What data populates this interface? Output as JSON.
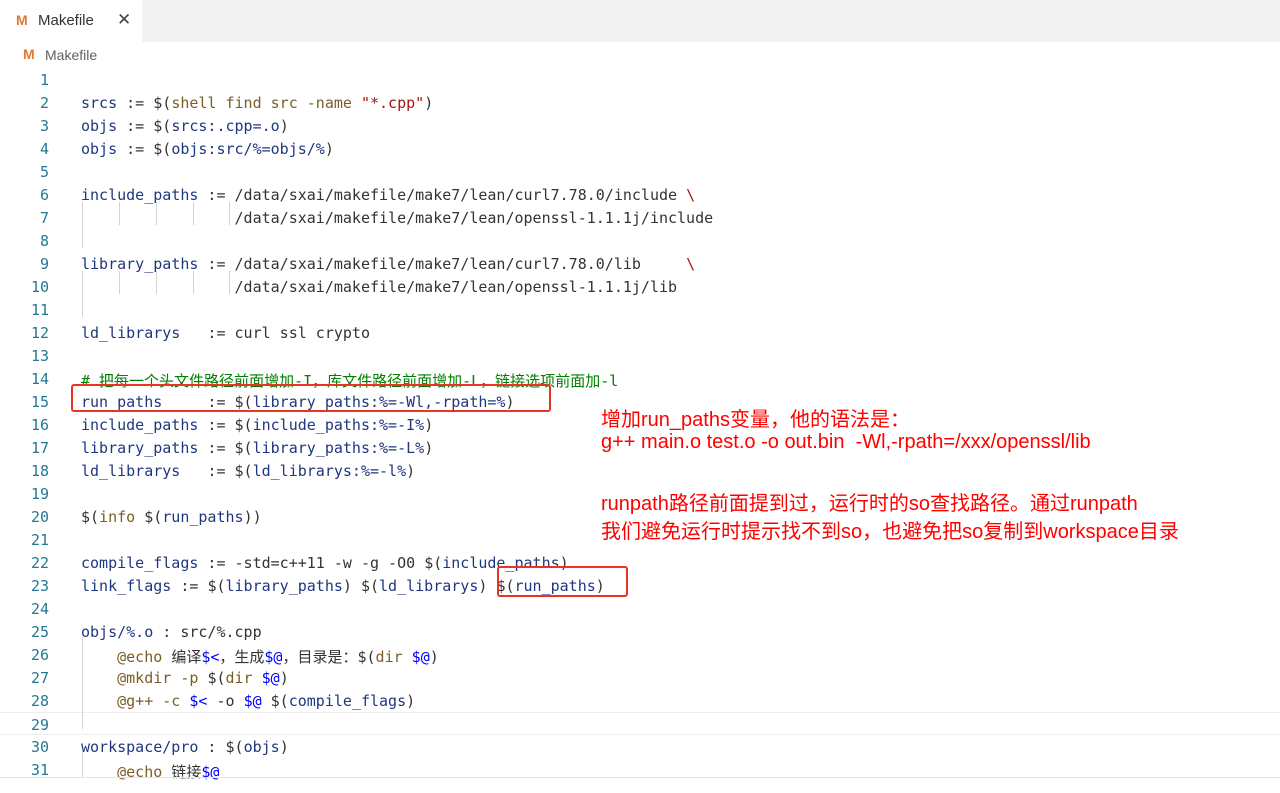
{
  "tab": {
    "icon": "M",
    "label": "Makefile",
    "close": "✕"
  },
  "breadcrumb": {
    "icon": "M",
    "label": "Makefile"
  },
  "lines": [
    {
      "n": "1",
      "seg": []
    },
    {
      "n": "2",
      "seg": [
        [
          "srcs",
          "c-var"
        ],
        [
          " := ",
          "c-op"
        ],
        [
          "$(",
          "c-op"
        ],
        [
          "shell find src -name ",
          "c-fn"
        ],
        [
          "\"*.cpp\"",
          "c-str"
        ],
        [
          ")",
          "c-op"
        ]
      ]
    },
    {
      "n": "3",
      "seg": [
        [
          "objs",
          "c-var"
        ],
        [
          " := ",
          "c-op"
        ],
        [
          "$(",
          "c-op"
        ],
        [
          "srcs:.cpp=.o",
          "c-var"
        ],
        [
          ")",
          "c-op"
        ]
      ]
    },
    {
      "n": "4",
      "seg": [
        [
          "objs",
          "c-var"
        ],
        [
          " := ",
          "c-op"
        ],
        [
          "$(",
          "c-op"
        ],
        [
          "objs:src/%=objs/%",
          "c-var"
        ],
        [
          ")",
          "c-op"
        ]
      ]
    },
    {
      "n": "5",
      "seg": []
    },
    {
      "n": "6",
      "seg": [
        [
          "include_paths",
          "c-var"
        ],
        [
          " := /data/sxai/makefile/make7/lean/curl7.78.0/include ",
          "c-op"
        ],
        [
          "\\",
          "c-esc"
        ]
      ]
    },
    {
      "n": "7",
      "seg": [
        [
          "                 /data/sxai/makefile/make7/lean/openssl-1.1.1j/include",
          "c-op"
        ]
      ]
    },
    {
      "n": "8",
      "seg": []
    },
    {
      "n": "9",
      "seg": [
        [
          "library_paths",
          "c-var"
        ],
        [
          " := /data/sxai/makefile/make7/lean/curl7.78.0/lib     ",
          "c-op"
        ],
        [
          "\\",
          "c-esc"
        ]
      ]
    },
    {
      "n": "10",
      "seg": [
        [
          "                 /data/sxai/makefile/make7/lean/openssl-1.1.1j/lib",
          "c-op"
        ]
      ]
    },
    {
      "n": "11",
      "seg": []
    },
    {
      "n": "12",
      "seg": [
        [
          "ld_librarys",
          "c-var"
        ],
        [
          "   := curl ssl crypto",
          "c-op"
        ]
      ]
    },
    {
      "n": "13",
      "seg": []
    },
    {
      "n": "14",
      "seg": [
        [
          "# 把每一个头文件路径前面增加-I，库文件路径前面增加-L，链接选项前面加-l",
          "c-com"
        ]
      ]
    },
    {
      "n": "15",
      "seg": [
        [
          "run_paths",
          "c-var"
        ],
        [
          "     := ",
          "c-op"
        ],
        [
          "$(",
          "c-op"
        ],
        [
          "library_paths:%=-Wl,-rpath=%",
          "c-var"
        ],
        [
          ")",
          "c-op"
        ]
      ]
    },
    {
      "n": "16",
      "seg": [
        [
          "include_paths",
          "c-var"
        ],
        [
          " := ",
          "c-op"
        ],
        [
          "$(",
          "c-op"
        ],
        [
          "include_paths:%=-I%",
          "c-var"
        ],
        [
          ")",
          "c-op"
        ]
      ]
    },
    {
      "n": "17",
      "seg": [
        [
          "library_paths",
          "c-var"
        ],
        [
          " := ",
          "c-op"
        ],
        [
          "$(",
          "c-op"
        ],
        [
          "library_paths:%=-L%",
          "c-var"
        ],
        [
          ")",
          "c-op"
        ]
      ]
    },
    {
      "n": "18",
      "seg": [
        [
          "ld_librarys",
          "c-var"
        ],
        [
          "   := ",
          "c-op"
        ],
        [
          "$(",
          "c-op"
        ],
        [
          "ld_librarys:%=-l%",
          "c-var"
        ],
        [
          ")",
          "c-op"
        ]
      ]
    },
    {
      "n": "19",
      "seg": []
    },
    {
      "n": "20",
      "seg": [
        [
          "$(",
          "c-op"
        ],
        [
          "info ",
          "c-fn"
        ],
        [
          "$(",
          "c-op"
        ],
        [
          "run_paths",
          "c-var"
        ],
        [
          "))",
          "c-op"
        ]
      ]
    },
    {
      "n": "21",
      "seg": []
    },
    {
      "n": "22",
      "seg": [
        [
          "compile_flags",
          "c-var"
        ],
        [
          " := -std=c++11 -w -g -O0 ",
          "c-op"
        ],
        [
          "$(",
          "c-op"
        ],
        [
          "include_paths",
          "c-var"
        ],
        [
          ")",
          "c-op"
        ]
      ]
    },
    {
      "n": "23",
      "seg": [
        [
          "link_flags",
          "c-var"
        ],
        [
          " := ",
          "c-op"
        ],
        [
          "$(",
          "c-op"
        ],
        [
          "library_paths",
          "c-var"
        ],
        [
          ") ",
          "c-op"
        ],
        [
          "$(",
          "c-op"
        ],
        [
          "ld_librarys",
          "c-var"
        ],
        [
          ") ",
          "c-op"
        ],
        [
          "$(",
          "c-op"
        ],
        [
          "run_paths",
          "c-var"
        ],
        [
          ")",
          "c-op"
        ]
      ]
    },
    {
      "n": "24",
      "seg": []
    },
    {
      "n": "25",
      "seg": [
        [
          "objs/%.o",
          "c-var"
        ],
        [
          " : src/%.cpp",
          "c-op"
        ]
      ]
    },
    {
      "n": "26",
      "seg": [
        [
          "    @echo ",
          "c-fn"
        ],
        [
          "编译",
          "c-txt"
        ],
        [
          "$<",
          "c-auto"
        ],
        [
          "，生成",
          "c-txt"
        ],
        [
          "$@",
          "c-auto"
        ],
        [
          "，目录是：",
          "c-txt"
        ],
        [
          "$(",
          "c-op"
        ],
        [
          "dir ",
          "c-fn"
        ],
        [
          "$@",
          "c-auto"
        ],
        [
          ")",
          "c-op"
        ]
      ]
    },
    {
      "n": "27",
      "seg": [
        [
          "    @mkdir -p ",
          "c-fn"
        ],
        [
          "$(",
          "c-op"
        ],
        [
          "dir ",
          "c-fn"
        ],
        [
          "$@",
          "c-auto"
        ],
        [
          ")",
          "c-op"
        ]
      ]
    },
    {
      "n": "28",
      "seg": [
        [
          "    @g++ -c ",
          "c-fn"
        ],
        [
          "$<",
          "c-auto"
        ],
        [
          " -o ",
          "c-op"
        ],
        [
          "$@",
          "c-auto"
        ],
        [
          " ",
          "c-op"
        ],
        [
          "$(",
          "c-op"
        ],
        [
          "compile_flags",
          "c-var"
        ],
        [
          ")",
          "c-op"
        ]
      ]
    },
    {
      "n": "29",
      "seg": []
    },
    {
      "n": "30",
      "seg": [
        [
          "workspace/pro",
          "c-var"
        ],
        [
          " : ",
          "c-op"
        ],
        [
          "$(",
          "c-op"
        ],
        [
          "objs",
          "c-var"
        ],
        [
          ")",
          "c-op"
        ]
      ]
    },
    {
      "n": "31",
      "seg": [
        [
          "    @echo ",
          "c-fn"
        ],
        [
          "链接",
          "c-txt"
        ],
        [
          "$@",
          "c-auto"
        ]
      ]
    }
  ],
  "notes": {
    "line1": "增加run_paths变量，他的语法是：",
    "line2": "g++ main.o test.o -o out.bin  -Wl,-rpath=/xxx/openssl/lib",
    "line3": "runpath路径前面提到过，运行时的so查找路径。通过runpath",
    "line4": "我们避免运行时提示找不到so，也避免把so复制到workspace目录"
  },
  "colors": {
    "highlight_box": "#ea3323",
    "note_text": "#ff0000",
    "line_number": "#237893"
  }
}
